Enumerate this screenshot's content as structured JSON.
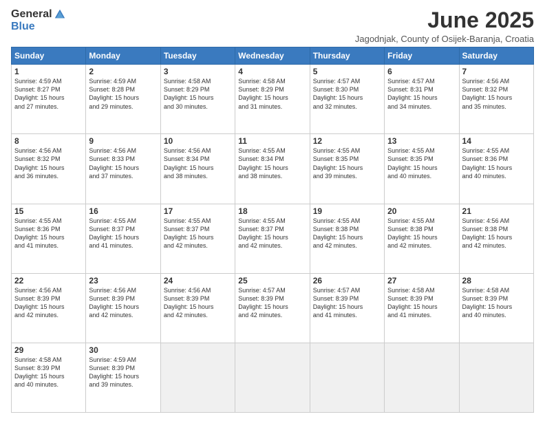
{
  "logo": {
    "general": "General",
    "blue": "Blue"
  },
  "title": "June 2025",
  "subtitle": "Jagodnjak, County of Osijek-Baranja, Croatia",
  "days_header": [
    "Sunday",
    "Monday",
    "Tuesday",
    "Wednesday",
    "Thursday",
    "Friday",
    "Saturday"
  ],
  "weeks": [
    [
      {
        "day": "1",
        "info": "Sunrise: 4:59 AM\nSunset: 8:27 PM\nDaylight: 15 hours\nand 27 minutes."
      },
      {
        "day": "2",
        "info": "Sunrise: 4:59 AM\nSunset: 8:28 PM\nDaylight: 15 hours\nand 29 minutes."
      },
      {
        "day": "3",
        "info": "Sunrise: 4:58 AM\nSunset: 8:29 PM\nDaylight: 15 hours\nand 30 minutes."
      },
      {
        "day": "4",
        "info": "Sunrise: 4:58 AM\nSunset: 8:29 PM\nDaylight: 15 hours\nand 31 minutes."
      },
      {
        "day": "5",
        "info": "Sunrise: 4:57 AM\nSunset: 8:30 PM\nDaylight: 15 hours\nand 32 minutes."
      },
      {
        "day": "6",
        "info": "Sunrise: 4:57 AM\nSunset: 8:31 PM\nDaylight: 15 hours\nand 34 minutes."
      },
      {
        "day": "7",
        "info": "Sunrise: 4:56 AM\nSunset: 8:32 PM\nDaylight: 15 hours\nand 35 minutes."
      }
    ],
    [
      {
        "day": "8",
        "info": "Sunrise: 4:56 AM\nSunset: 8:32 PM\nDaylight: 15 hours\nand 36 minutes."
      },
      {
        "day": "9",
        "info": "Sunrise: 4:56 AM\nSunset: 8:33 PM\nDaylight: 15 hours\nand 37 minutes."
      },
      {
        "day": "10",
        "info": "Sunrise: 4:56 AM\nSunset: 8:34 PM\nDaylight: 15 hours\nand 38 minutes."
      },
      {
        "day": "11",
        "info": "Sunrise: 4:55 AM\nSunset: 8:34 PM\nDaylight: 15 hours\nand 38 minutes."
      },
      {
        "day": "12",
        "info": "Sunrise: 4:55 AM\nSunset: 8:35 PM\nDaylight: 15 hours\nand 39 minutes."
      },
      {
        "day": "13",
        "info": "Sunrise: 4:55 AM\nSunset: 8:35 PM\nDaylight: 15 hours\nand 40 minutes."
      },
      {
        "day": "14",
        "info": "Sunrise: 4:55 AM\nSunset: 8:36 PM\nDaylight: 15 hours\nand 40 minutes."
      }
    ],
    [
      {
        "day": "15",
        "info": "Sunrise: 4:55 AM\nSunset: 8:36 PM\nDaylight: 15 hours\nand 41 minutes."
      },
      {
        "day": "16",
        "info": "Sunrise: 4:55 AM\nSunset: 8:37 PM\nDaylight: 15 hours\nand 41 minutes."
      },
      {
        "day": "17",
        "info": "Sunrise: 4:55 AM\nSunset: 8:37 PM\nDaylight: 15 hours\nand 42 minutes."
      },
      {
        "day": "18",
        "info": "Sunrise: 4:55 AM\nSunset: 8:37 PM\nDaylight: 15 hours\nand 42 minutes."
      },
      {
        "day": "19",
        "info": "Sunrise: 4:55 AM\nSunset: 8:38 PM\nDaylight: 15 hours\nand 42 minutes."
      },
      {
        "day": "20",
        "info": "Sunrise: 4:55 AM\nSunset: 8:38 PM\nDaylight: 15 hours\nand 42 minutes."
      },
      {
        "day": "21",
        "info": "Sunrise: 4:56 AM\nSunset: 8:38 PM\nDaylight: 15 hours\nand 42 minutes."
      }
    ],
    [
      {
        "day": "22",
        "info": "Sunrise: 4:56 AM\nSunset: 8:39 PM\nDaylight: 15 hours\nand 42 minutes."
      },
      {
        "day": "23",
        "info": "Sunrise: 4:56 AM\nSunset: 8:39 PM\nDaylight: 15 hours\nand 42 minutes."
      },
      {
        "day": "24",
        "info": "Sunrise: 4:56 AM\nSunset: 8:39 PM\nDaylight: 15 hours\nand 42 minutes."
      },
      {
        "day": "25",
        "info": "Sunrise: 4:57 AM\nSunset: 8:39 PM\nDaylight: 15 hours\nand 42 minutes."
      },
      {
        "day": "26",
        "info": "Sunrise: 4:57 AM\nSunset: 8:39 PM\nDaylight: 15 hours\nand 41 minutes."
      },
      {
        "day": "27",
        "info": "Sunrise: 4:58 AM\nSunset: 8:39 PM\nDaylight: 15 hours\nand 41 minutes."
      },
      {
        "day": "28",
        "info": "Sunrise: 4:58 AM\nSunset: 8:39 PM\nDaylight: 15 hours\nand 40 minutes."
      }
    ],
    [
      {
        "day": "29",
        "info": "Sunrise: 4:58 AM\nSunset: 8:39 PM\nDaylight: 15 hours\nand 40 minutes."
      },
      {
        "day": "30",
        "info": "Sunrise: 4:59 AM\nSunset: 8:39 PM\nDaylight: 15 hours\nand 39 minutes."
      },
      {
        "day": "",
        "info": ""
      },
      {
        "day": "",
        "info": ""
      },
      {
        "day": "",
        "info": ""
      },
      {
        "day": "",
        "info": ""
      },
      {
        "day": "",
        "info": ""
      }
    ]
  ]
}
